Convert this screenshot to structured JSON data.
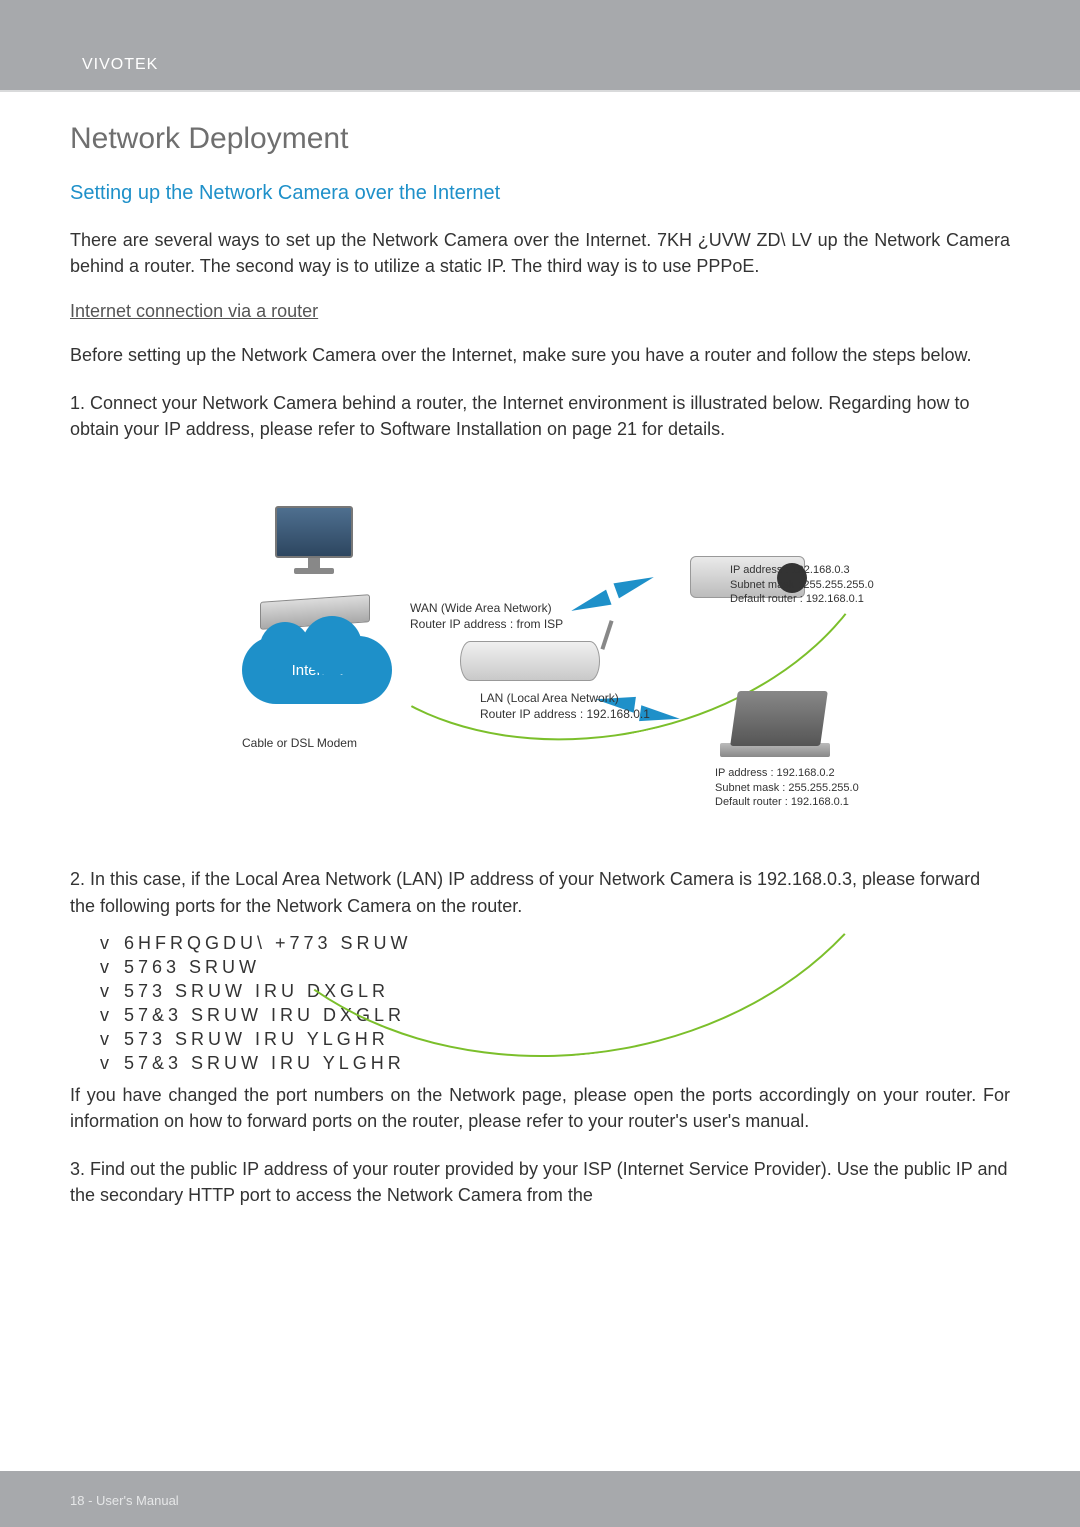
{
  "brand": "VIVOTEK",
  "sections": {
    "title": "Network Deployment",
    "subtitle": "Setting up the Network Camera over the Internet",
    "intro": "There are several ways to set up the Network Camera over the Internet. 7KH ¿UVW ZD\\ LV up the Network Camera behind a router. The second way is to utilize a static IP. The third way is to use PPPoE.",
    "subhead": "Internet connection via a router",
    "before": "Before setting up the Network Camera over the Internet, make sure you have a router and follow the steps below.",
    "step1": "1. Connect your Network Camera behind a router, the Internet environment is illustrated below. Regarding how to obtain your IP address, please refer to Software Installation on page 21 for details.",
    "step2": "2. In this case, if the Local Area Network (LAN) IP address of your Network Camera is 192.168.0.3, please forward the following ports for the Network Camera on the router.",
    "ports_note": "If you have changed the port numbers on the Network page, please open the ports accordingly on your router. For information on how to forward ports on the router, please refer to your router's user's manual.",
    "step3": "3. Find out the public IP address of your router provided by your ISP (Internet Service Provider). Use the public IP and the secondary HTTP port to access the Network Camera from the"
  },
  "diagram": {
    "internet": "Internet",
    "wan_line1": "WAN (Wide Area Network)",
    "wan_line2": "Router IP address : from ISP",
    "lan_line1": "LAN (Local Area Network)",
    "lan_line2": "Router IP address : 192.168.0.1",
    "modem_label": "Cable or DSL Modem",
    "camera_ip": "IP address : 192.168.0.3",
    "camera_mask": "Subnet mask : 255.255.255.0",
    "camera_gw": "Default router : 192.168.0.1",
    "laptop_ip": "IP address : 192.168.0.2",
    "laptop_mask": "Subnet mask : 255.255.255.0",
    "laptop_gw": "Default router : 192.168.0.1"
  },
  "port_list": [
    "6HFRQGDU\\ +773 SRUW",
    "5763 SRUW",
    "573 SRUW IRU DXGLR",
    "57&3 SRUW IRU DXGLR",
    "573 SRUW IRU YLGHR",
    "57&3 SRUW IRU YLGHR"
  ],
  "footer": "18 - User's Manual"
}
